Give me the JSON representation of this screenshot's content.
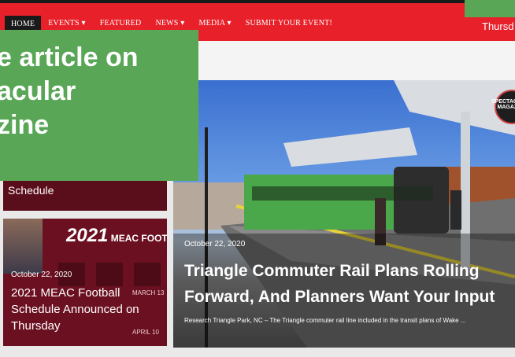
{
  "nav": {
    "items": [
      "HOME",
      "EVENTS",
      "FEATURED",
      "NEWS",
      "MEDIA",
      "SUBMIT YOUR EVENT!"
    ],
    "dropdown_indicator": "▾",
    "date_partial": "Thursd"
  },
  "overlay": {
    "lines": [
      "e article on",
      "acular",
      "zine"
    ]
  },
  "sidebar": {
    "card1_title": "Schedule",
    "card2": {
      "header_year": "2021",
      "header_text": "MEAC FOOTBALL SCHEDULE",
      "date": "October 22, 2020",
      "title": "2021 MEAC Football Schedule Announced on Thursday",
      "tile_labels": [
        "MARCH 13",
        "APRIL 10"
      ]
    }
  },
  "hero": {
    "logo_text": "SPECTACULAR MAGAZINE",
    "date": "October 22, 2020",
    "title": "Triangle Commuter Rail Plans Rolling Forward, And Planners Want Your Input",
    "excerpt": "Research Triangle Park, NC – The Triangle commuter rail line included in the transit plans of Wake ..."
  },
  "colors": {
    "nav_bg": "#e8202a",
    "overlay_bg": "#5aa657",
    "card_bg": "#6b1020"
  }
}
